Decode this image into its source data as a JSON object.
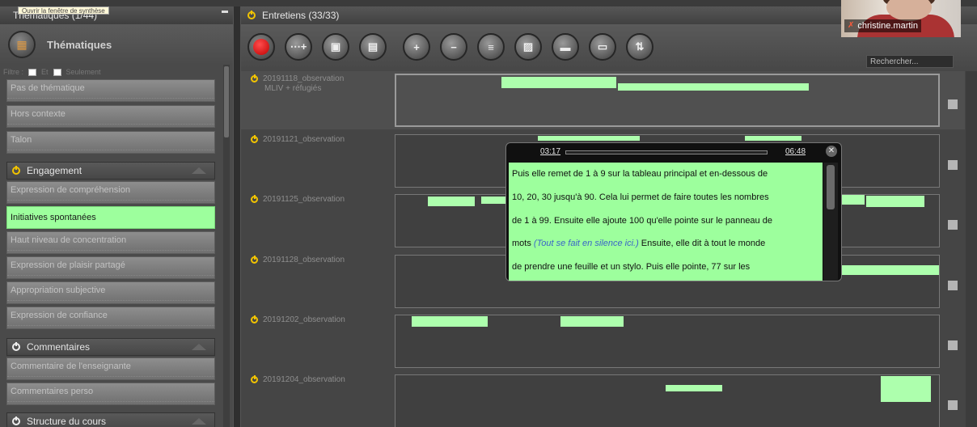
{
  "left": {
    "tooltip": "Ouvrir la fenêtre de synthèse",
    "header": "Thématiques (1/44)",
    "toolbar_title": "Thématiques",
    "filter": {
      "label": "Filtre :",
      "et": "Et",
      "seulement": "Seulement"
    },
    "items_top": [
      "Pas de thématique",
      "Hors contexte",
      "Talon"
    ],
    "section_engagement": "Engagement",
    "engagement_items": [
      "Expression de compréhension",
      "Initiatives spontanées",
      "Haut niveau de concentration",
      "Expression de plaisir partagé",
      "Appropriation subjective",
      "Expression de confiance"
    ],
    "section_commentaires": "Commentaires",
    "commentaires_items": [
      "Commentaire de l'enseignante",
      "Commentaires perso"
    ],
    "section_structure": "Structure du cours"
  },
  "right": {
    "header": "Entretiens (33/33)",
    "search_placeholder": "Rechercher...",
    "rows": [
      {
        "label": "20191118_observation",
        "sub": "MLIV + réfugiés"
      },
      {
        "label": "20191121_observation",
        "sub": ""
      },
      {
        "label": "20191125_observation",
        "sub": ""
      },
      {
        "label": "20191128_observation",
        "sub": ""
      },
      {
        "label": "20191202_observation",
        "sub": ""
      },
      {
        "label": "20191204_observation",
        "sub": ""
      }
    ]
  },
  "popup": {
    "time_start": "03:17",
    "time_end": "06:48",
    "close": "✕",
    "lines": [
      "Puis elle remet de 1 à 9 sur la tableau principal et en-dessous de",
      "10, 20, 30 jusqu'à 90.  Cela lui permet de faire toutes les nombres",
      "de 1 à 99.  Ensuite elle ajoute 100 qu'elle pointe sur le panneau de"
    ],
    "line4_a": "mots ",
    "line4_note": "(Tout se fait en silence ici.)",
    "line4_b": " Ensuite,  elle dit à tout le monde",
    "line5": "de prendre une feuille et un stylo.    Puis elle pointe,  77 sur les"
  },
  "webcam": {
    "name": "christine.martin"
  },
  "colors": {
    "segment": "#adffad",
    "selected": "#9dff9d",
    "record": "#e00000",
    "accent": "#f2c400"
  }
}
